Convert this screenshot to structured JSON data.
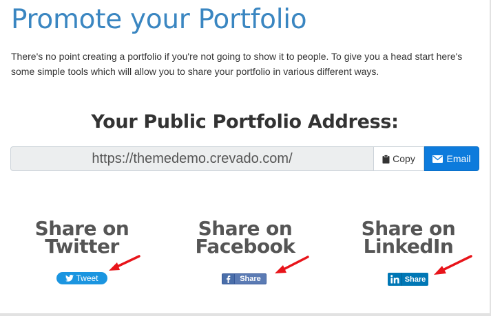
{
  "page": {
    "title": "Promote your Portfolio",
    "intro": "There's no point creating a portfolio if you're not going to show it to people. To give you a head start here's some simple tools which will allow you to share your portfolio in various different ways."
  },
  "address": {
    "heading": "Your Public Portfolio Address:",
    "url": "https://themedemo.crevado.com/",
    "copy_label": "Copy",
    "email_label": "Email"
  },
  "share": {
    "twitter": {
      "title_line1": "Share on",
      "title_line2": "Twitter",
      "button_label": "Tweet"
    },
    "facebook": {
      "title_line1": "Share on",
      "title_line2": "Facebook",
      "button_label": "Share"
    },
    "linkedin": {
      "title_line1": "Share on",
      "title_line2": "LinkedIn",
      "button_label": "Share"
    }
  },
  "icons": {
    "copy": "clipboard-icon",
    "email": "envelope-icon",
    "twitter": "twitter-bird-icon",
    "facebook": "facebook-f-icon",
    "linkedin": "linkedin-in-icon",
    "arrows": "red-arrow-icon"
  },
  "colors": {
    "title": "#3a86c1",
    "email_button": "#0d7bdc",
    "twitter": "#1b95e0",
    "facebook": "#4267b2",
    "linkedin": "#0077b5",
    "arrow": "#e8141a"
  }
}
